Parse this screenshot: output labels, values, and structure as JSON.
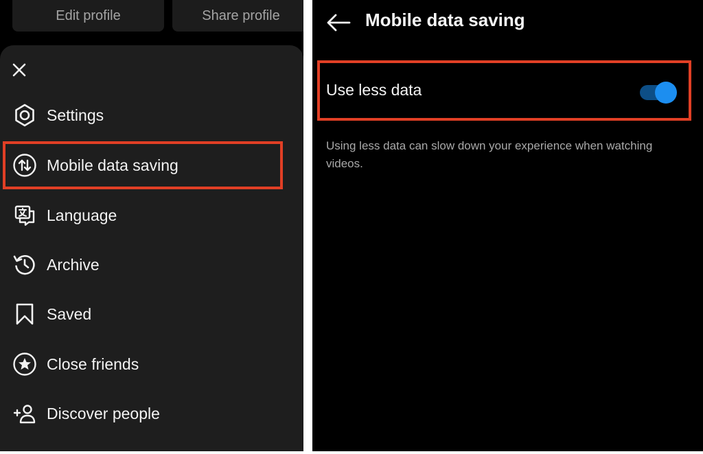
{
  "left": {
    "top_buttons": {
      "edit_profile": "Edit profile",
      "share_profile": "Share profile"
    },
    "menu": {
      "close_icon": "close-icon",
      "items": [
        {
          "label": "Settings",
          "icon": "gear-icon"
        },
        {
          "label": "Mobile data saving",
          "icon": "data-arrows-icon",
          "highlighted": true
        },
        {
          "label": "Language",
          "icon": "translate-icon"
        },
        {
          "label": "Archive",
          "icon": "archive-history-icon"
        },
        {
          "label": "Saved",
          "icon": "bookmark-icon"
        },
        {
          "label": "Close friends",
          "icon": "star-circle-icon"
        },
        {
          "label": "Discover people",
          "icon": "add-person-icon"
        }
      ]
    }
  },
  "right": {
    "header": {
      "title": "Mobile data saving",
      "back_icon": "back-arrow-icon"
    },
    "setting": {
      "label": "Use less data",
      "toggle_on": true,
      "highlighted": true
    },
    "helper_text": "Using less data can slow down your experience when watching videos."
  },
  "colors": {
    "background": "#000000",
    "sheet": "#1e1e1e",
    "highlight": "#e13f25",
    "toggle_knob": "#1c8ef0",
    "toggle_track": "#0d4e86",
    "secondary_text": "#a9a9a9"
  }
}
